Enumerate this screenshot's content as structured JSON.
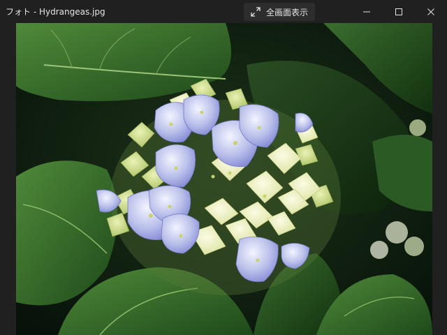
{
  "window": {
    "title": "フォト - Hydrangeas.jpg"
  },
  "toolbar": {
    "fullscreen_label": "全画面表示",
    "fullscreen_icon": "expand-arrows-icon"
  },
  "caption_buttons": {
    "minimize_icon": "minimize-icon",
    "maximize_icon": "maximize-icon",
    "close_icon": "close-icon"
  },
  "photo": {
    "subject_icon": "hydrangea-photo"
  },
  "colors": {
    "titlebar_bg": "#202020",
    "button_bg": "#2d2d2d",
    "text": "#e6e6e6"
  }
}
